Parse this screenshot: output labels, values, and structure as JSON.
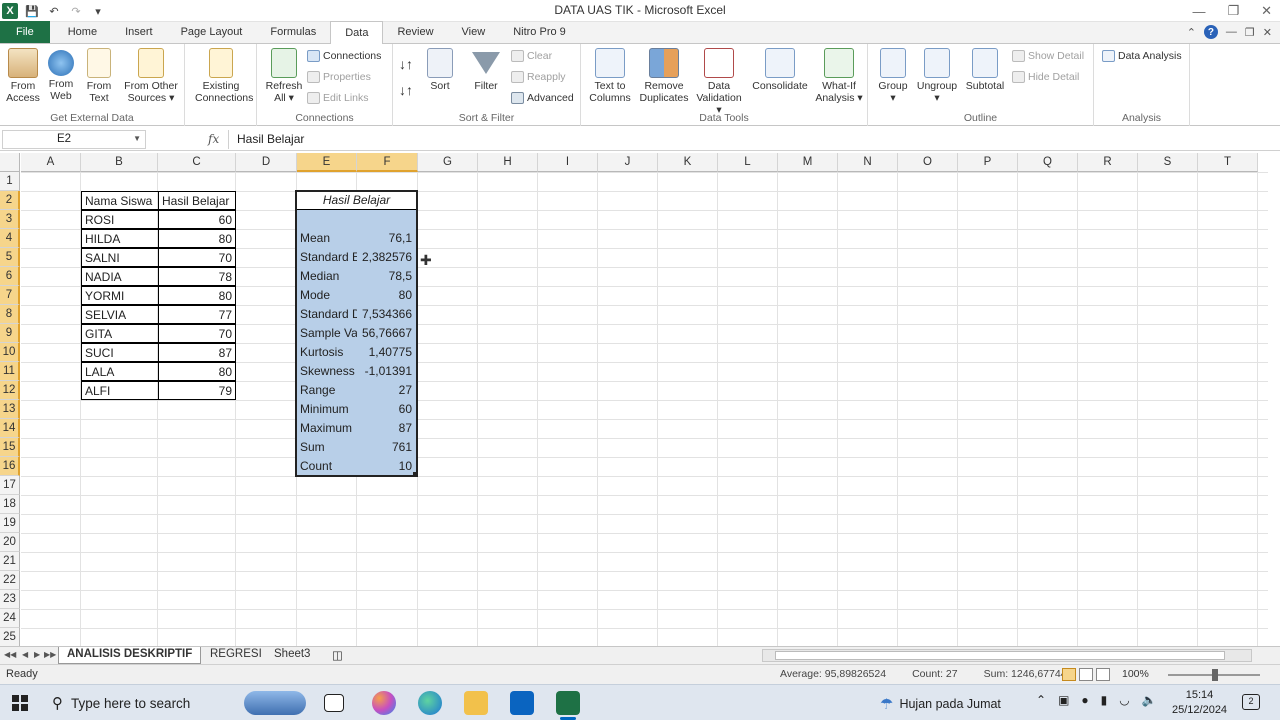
{
  "window": {
    "title": "DATA UAS TIK  -  Microsoft Excel"
  },
  "ribbon": {
    "tabs": [
      "File",
      "Home",
      "Insert",
      "Page Layout",
      "Formulas",
      "Data",
      "Review",
      "View",
      "Nitro Pro 9"
    ],
    "active_tab": "Data",
    "groups": {
      "get_external": {
        "label": "Get External Data",
        "from_access": "From\nAccess",
        "from_web": "From\nWeb",
        "from_text": "From\nText",
        "from_other": "From Other\nSources ▾",
        "existing": "Existing\nConnections"
      },
      "connections": {
        "label": "Connections",
        "refresh": "Refresh\nAll ▾",
        "connections": "Connections",
        "properties": "Properties",
        "edit_links": "Edit Links"
      },
      "sort_filter": {
        "label": "Sort & Filter",
        "sort": "Sort",
        "filter": "Filter",
        "clear": "Clear",
        "reapply": "Reapply",
        "advanced": "Advanced"
      },
      "data_tools": {
        "label": "Data Tools",
        "text_to_columns": "Text to\nColumns",
        "remove_duplicates": "Remove\nDuplicates",
        "data_validation": "Data\nValidation ▾",
        "consolidate": "Consolidate",
        "what_if": "What-If\nAnalysis ▾"
      },
      "outline": {
        "label": "Outline",
        "group": "Group\n▾",
        "ungroup": "Ungroup\n▾",
        "subtotal": "Subtotal",
        "show_detail": "Show Detail",
        "hide_detail": "Hide Detail"
      },
      "analysis": {
        "label": "Analysis",
        "data_analysis": "Data Analysis"
      }
    }
  },
  "formula_bar": {
    "name_box": "E2",
    "fx": "fx",
    "formula": "Hasil Belajar"
  },
  "sheet": {
    "columns": [
      "A",
      "B",
      "C",
      "D",
      "E",
      "F",
      "G",
      "H",
      "I",
      "J",
      "K",
      "L",
      "M",
      "N",
      "O",
      "P",
      "Q",
      "R",
      "S",
      "T"
    ],
    "rows": [
      "1",
      "2",
      "3",
      "4",
      "5",
      "6",
      "7",
      "8",
      "9",
      "10",
      "11",
      "12",
      "13",
      "14",
      "15",
      "16",
      "17",
      "18",
      "19",
      "20",
      "21",
      "22",
      "23",
      "24",
      "25"
    ],
    "selected_columns": [
      "E",
      "F"
    ],
    "selected_rows": [
      "2",
      "3",
      "4",
      "5",
      "6",
      "7",
      "8",
      "9",
      "10",
      "11",
      "12",
      "13",
      "14",
      "15",
      "16"
    ],
    "student_table": {
      "headers": [
        "Nama Siswa",
        "Hasil Belajar"
      ],
      "rows": [
        [
          "ROSI",
          "60"
        ],
        [
          "HILDA",
          "80"
        ],
        [
          "SALNI",
          "70"
        ],
        [
          "NADIA",
          "78"
        ],
        [
          "YORMI",
          "80"
        ],
        [
          "SELVIA",
          "77"
        ],
        [
          "GITA",
          "70"
        ],
        [
          "SUCI",
          "87"
        ],
        [
          "LALA",
          "80"
        ],
        [
          "ALFI",
          "79"
        ]
      ]
    },
    "stats_table": {
      "title": "Hasil Belajar",
      "rows": [
        [
          "Mean",
          "76,1"
        ],
        [
          "Standard E",
          "2,382576"
        ],
        [
          "Median",
          "78,5"
        ],
        [
          "Mode",
          "80"
        ],
        [
          "Standard D",
          "7,534366"
        ],
        [
          "Sample Va",
          "56,76667"
        ],
        [
          "Kurtosis",
          "1,40775"
        ],
        [
          "Skewness",
          "-1,01391"
        ],
        [
          "Range",
          "27"
        ],
        [
          "Minimum",
          "60"
        ],
        [
          "Maximum",
          "87"
        ],
        [
          "Sum",
          "761"
        ],
        [
          "Count",
          "10"
        ]
      ]
    }
  },
  "sheet_tabs": [
    "ANALISIS DESKRIPTIF",
    "REGRESI",
    "Sheet3"
  ],
  "active_sheet": "ANALISIS DESKRIPTIF",
  "status_bar": {
    "ready": "Ready",
    "average": "Average: 95,89826524",
    "count": "Count: 27",
    "sum": "Sum: 1246,677448",
    "zoom": "100%"
  },
  "taskbar": {
    "search_placeholder": "Type here to search",
    "weather": "Hujan pada Jumat",
    "time": "15:14",
    "date": "25/12/2024",
    "notifications": "2"
  }
}
